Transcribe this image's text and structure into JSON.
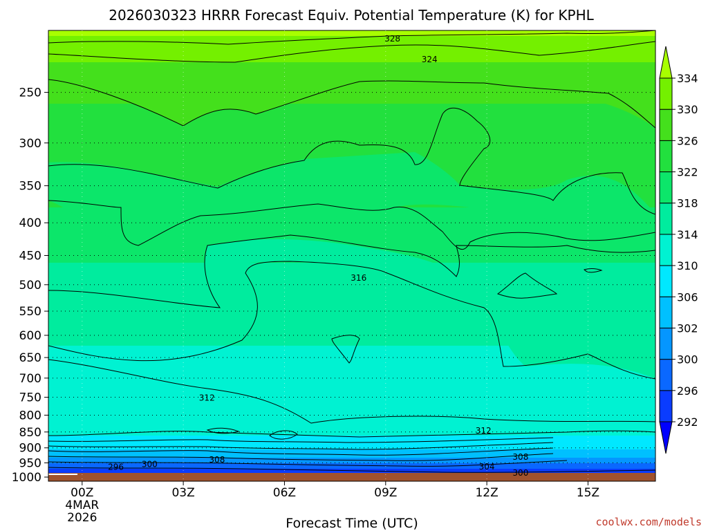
{
  "chart_data": {
    "type": "heatmap",
    "title": "2026030323 HRRR Forecast Equiv. Potential Temperature (K) for KPHL",
    "xlabel": "Forecast Time (UTC)",
    "ylabel": "",
    "x_ticks": [
      {
        "t": 0,
        "lines": [
          "00Z",
          "4MAR",
          "2026"
        ]
      },
      {
        "t": 3,
        "lines": [
          "03Z"
        ]
      },
      {
        "t": 6,
        "lines": [
          "06Z"
        ]
      },
      {
        "t": 9,
        "lines": [
          "09Z"
        ]
      },
      {
        "t": 12,
        "lines": [
          "12Z"
        ]
      },
      {
        "t": 15,
        "lines": [
          "15Z"
        ]
      }
    ],
    "xlim": [
      -1,
      17
    ],
    "y_ticks": [
      "250",
      "300",
      "350",
      "400",
      "450",
      "500",
      "550",
      "600",
      "650",
      "700",
      "750",
      "800",
      "850",
      "900",
      "950",
      "1000"
    ],
    "ylim": [
      1015,
      200
    ],
    "y_scale": "log",
    "colorbar": {
      "levels": [
        "292",
        "296",
        "300",
        "302",
        "306",
        "310",
        "314",
        "318",
        "322",
        "326",
        "330",
        "334"
      ],
      "colors": [
        "#0000ff",
        "#0a3cff",
        "#0a68ff",
        "#0596ff",
        "#00c0ff",
        "#00e8ff",
        "#00f2d2",
        "#00ec9e",
        "#0ce66a",
        "#22e03e",
        "#44e01c",
        "#74f000",
        "#a8ff00"
      ],
      "extend": "both"
    },
    "contour_labels": [
      {
        "text": "328",
        "t": 9.2,
        "p": 206
      },
      {
        "text": "324",
        "t": 10.3,
        "p": 222
      },
      {
        "text": "316",
        "t": 8.2,
        "p": 488
      },
      {
        "text": "312",
        "t": 3.7,
        "p": 752
      },
      {
        "text": "312",
        "t": 11.9,
        "p": 846
      },
      {
        "text": "308",
        "t": 4.0,
        "p": 940
      },
      {
        "text": "308",
        "t": 13.0,
        "p": 930
      },
      {
        "text": "300",
        "t": 2.0,
        "p": 955
      },
      {
        "text": "296",
        "t": 1.0,
        "p": 965
      },
      {
        "text": "304",
        "t": 12.0,
        "p": 963
      },
      {
        "text": "300",
        "t": 13.0,
        "p": 985
      }
    ],
    "surface_color": "#a0522d",
    "grid": "dotted-horizontal",
    "colorbar_placement": "right"
  },
  "credit": "coolwx.com/models"
}
